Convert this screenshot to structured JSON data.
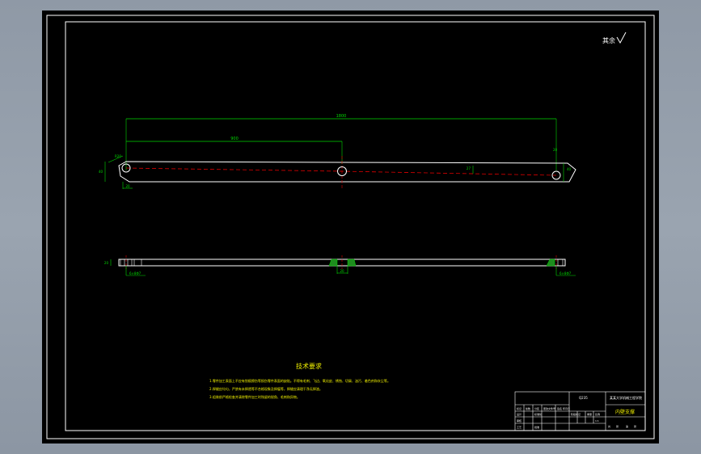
{
  "drawing": {
    "roughness_symbol": "其余",
    "dimensions": {
      "overall_length": "1800",
      "center_offset": "900",
      "left_eye_height": "40",
      "left_eye_radius": "R20",
      "left_eye_bottom": "20",
      "right_eye_top": "20",
      "right_eye_side": "40",
      "center_note": "27",
      "side_thickness": "20",
      "side_bottom_center": "20",
      "side_weld_left": "6×8Φ7",
      "side_weld_right": "6×8Φ7"
    },
    "notes": {
      "title": "技术要求",
      "lines": [
        "1.零件加工表面上不应有划痕擦伤等损伤零件表面的缺陷。不得有毛刺、飞边、氧化皮、锈蚀、切屑、油污、着色剂和灰尘等。",
        "2.焊缝应均匀，严禁有未焊透等不合格现象及焊瘤等，焊缝应清理干净无焊渣。",
        "3.组装前严格检查并清除零件加工时残留的锐角、毛刺和异物。"
      ]
    },
    "title_block": {
      "material": "Q235",
      "school": "某某大学机械工程学院",
      "drawing_name": "内壁支撑",
      "cells": [
        "标记",
        "处数",
        "分区",
        "更改文件号",
        "签名",
        "年月日",
        "设计",
        "标准化",
        "阶段标记",
        "重量",
        "比例",
        "审核",
        "工艺",
        "批准",
        "共",
        "张",
        "第",
        "张",
        "1:1"
      ]
    }
  }
}
